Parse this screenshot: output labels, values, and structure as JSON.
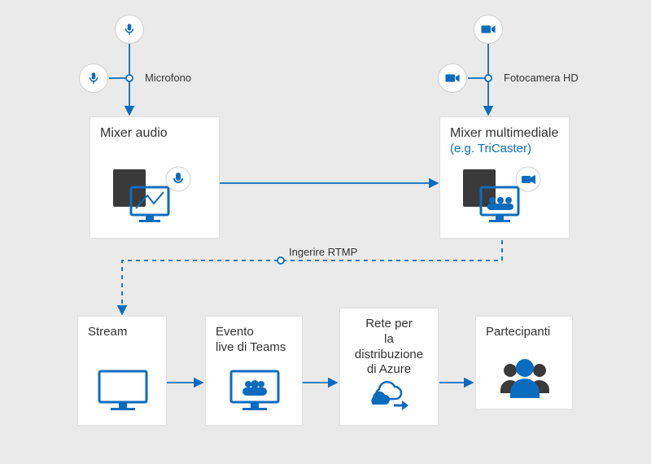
{
  "labels": {
    "microphone": "Microfono",
    "camera": "Fotocamera HD",
    "ingest": "Ingerire RTMP"
  },
  "boxes": {
    "audio_mixer": {
      "title": "Mixer audio"
    },
    "media_mixer": {
      "title": "Mixer multimediale",
      "subtitle": "(e.g. TriCaster)"
    },
    "stream": {
      "title": "Stream"
    },
    "teams_live": {
      "title": "Evento\nlive di Teams"
    },
    "azure_cdn": {
      "title": "Rete per\nla distribuzione di Azure"
    },
    "attendees": {
      "title": "Partecipanti"
    }
  },
  "colors": {
    "accent": "#0b6cbf",
    "icon": "#0b6cbf"
  }
}
